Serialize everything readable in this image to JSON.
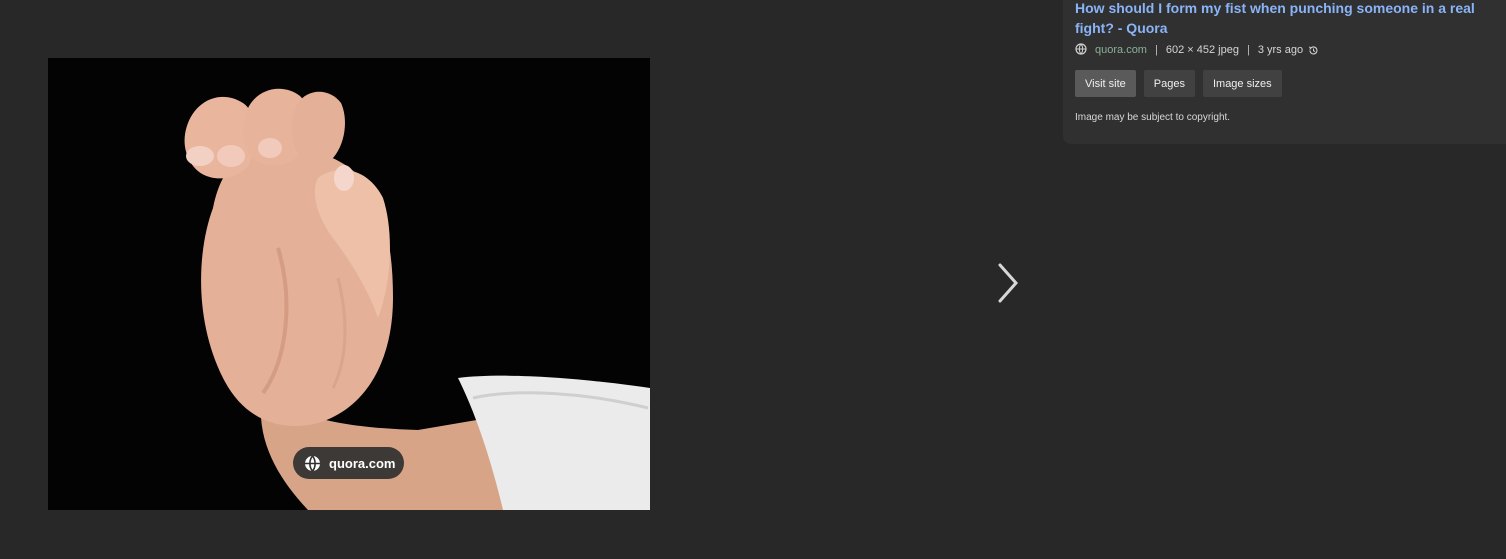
{
  "viewer": {
    "image_alt": "Hand forming a fist",
    "source_chip": "quora.com",
    "next_icon": "chevron-right-icon"
  },
  "info": {
    "title": "How should I form my fist when punching someone in a real fight? - Quora",
    "domain": "quora.com",
    "dimensions": "602 × 452 jpeg",
    "age": "3 yrs ago",
    "separator": "|",
    "buttons": {
      "visit": "Visit site",
      "pages": "Pages",
      "sizes": "Image sizes"
    },
    "copyright": "Image may be subject to copyright."
  },
  "colors": {
    "background": "#282828",
    "panel": "#303030",
    "link": "#8ab4f8"
  }
}
